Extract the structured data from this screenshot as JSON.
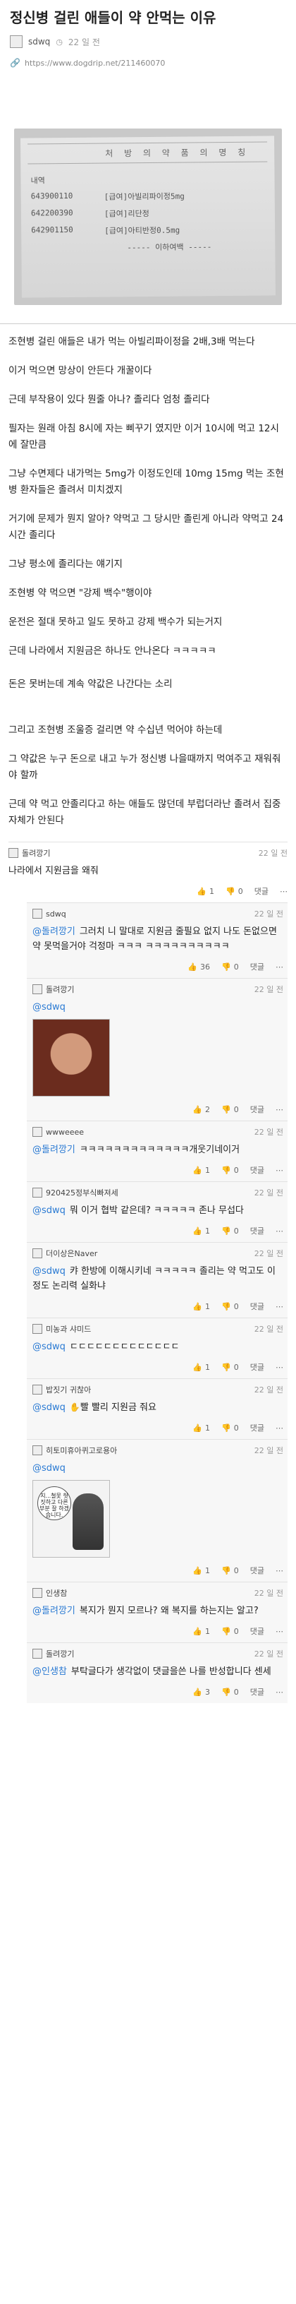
{
  "post": {
    "title": "정신병 걸린 애들이 약 안먹는 이유",
    "author": "sdwq",
    "date": "22 일 전",
    "source_url": "https://www.dogdrip.net/211460070"
  },
  "prescription": {
    "header": "처 방 의 약 품 의 명 칭",
    "label": "내역",
    "rows": [
      {
        "code": "643900110",
        "name": "[급여]아빌리파이정5mg"
      },
      {
        "code": "642200390",
        "name": "[급여]리단정"
      },
      {
        "code": "642901150",
        "name": "[급여]아티반정0.5mg"
      }
    ],
    "footer": "----- 이하여백 -----"
  },
  "body": [
    "조현병 걸린 애들은 내가 먹는 아빌리파이정을 2배,3배 먹는다",
    "이거 먹으면 망상이 안든다 개꿀이다",
    "근데 부작용이 있다 뭔줄 아나? 졸리다 엄청 졸리다",
    "필자는 원래 아침 8시에 자는 삐꾸기 였지만 이거 10시에 먹고 12시에 잘만큼",
    "그냥 수면제다 내가먹는 5mg가 이정도인데 10mg 15mg 먹는 조현병 환자들은 졸려서 미치겠지",
    "거기에 문제가 뭔지 알아? 약먹고 그 당시만 졸린게 아니라 약먹고 24시간 졸리다",
    "그냥 평소에 졸리다는 얘기지",
    "조현병 약 먹으면 \"강제 백수\"행이야",
    "운전은 절대 못하고 일도 못하고 강제 백수가 되는거지",
    "근데 나라에서 지원금은 하나도 안나온다 ㅋㅋㅋㅋㅋ",
    "돈은 못버는데 계속 약값은 나간다는 소리",
    "그리고 조현병 조울증 걸리면 약 수십년 먹어야 하는데",
    "그 약값은 누구 돈으로 내고 누가 정신병 나을때까지 먹여주고 재워줘야 할까",
    "근데 약 먹고 안졸리다고 하는 애들도 많던데 부럽더라난 졸려서 집중 자체가 안된다"
  ],
  "ui": {
    "reply_label": "댓글",
    "more_icon": "⋯",
    "up_icon": "thumb-up-icon",
    "down_icon": "thumb-down-icon"
  },
  "comments": [
    {
      "author": "돌려깡기",
      "time": "22 일 전",
      "mention": "",
      "text": "나라에서 지원금을 왜줘",
      "up": "1",
      "down": "0",
      "reply": false
    },
    {
      "author": "sdwq",
      "time": "22 일 전",
      "mention": "@돌려깡기",
      "text": "그러치 니 말대로 지원금 줄필요 없지 나도 돈없으면 약 못먹을거야 걱정마 ㅋㅋㅋ ㅋㅋㅋㅋㅋㅋㅋㅋㅋㅋ",
      "up": "36",
      "down": "0",
      "reply": true
    },
    {
      "author": "돌려깡기",
      "time": "22 일 전",
      "mention": "@sdwq",
      "text": "",
      "up": "2",
      "down": "0",
      "reply": true
    },
    {
      "author": "wwweeee",
      "time": "22 일 전",
      "mention": "@돌려깡기",
      "text": "ㅋㅋㅋㅋㅋㅋㅋㅋㅋㅋㅋㅋㅋ개웃기네이거",
      "up": "1",
      "down": "0",
      "reply": true
    },
    {
      "author": "920425정부식빠져세",
      "time": "22 일 전",
      "mention": "@sdwq",
      "text": "뭐 이거 협박 같은데? ㅋㅋㅋㅋㅋ 존나 무섭다",
      "up": "1",
      "down": "0",
      "reply": true
    },
    {
      "author": "더이상은Naver",
      "time": "22 일 전",
      "mention": "@sdwq",
      "text": "캬 한방에 이해시키네 ㅋㅋㅋㅋㅋ 졸리는 약 먹고도 이정도 논리력 실화냐",
      "up": "1",
      "down": "0",
      "reply": true
    },
    {
      "author": "미농과 샤미드",
      "time": "22 일 전",
      "mention": "@sdwq",
      "text": "ㄷㄷㄷㄷㄷㄷㄷㄷㄷㄷㄷㄷㄷ",
      "up": "1",
      "down": "0",
      "reply": true
    },
    {
      "author": "밥짓기 귀찮아",
      "time": "22 일 전",
      "mention": "@sdwq",
      "text": "빨 빨리 지원금 줘요",
      "up": "1",
      "down": "0",
      "reply": true
    },
    {
      "author": "히토미휴아퀴고로용아",
      "time": "22 일 전",
      "mention": "@sdwq",
      "text": "",
      "up": "1",
      "down": "0",
      "reply": true
    },
    {
      "author": "인생참",
      "time": "22 일 전",
      "mention": "@돌려깡기",
      "text": "복지가 뭔지 모르나? 왜 복지를 하는지는 알고?",
      "up": "1",
      "down": "0",
      "reply": true
    },
    {
      "author": "돌려깡기",
      "time": "22 일 전",
      "mention": "@인생참",
      "text": "부탁글다가 생각없이 댓글을쓴 나를 반성합니다 센세",
      "up": "3",
      "down": "0",
      "reply": true
    }
  ],
  "cartoon_bubble": "지...철못 헛짓하고 다른부분 잘 하겠습니다."
}
